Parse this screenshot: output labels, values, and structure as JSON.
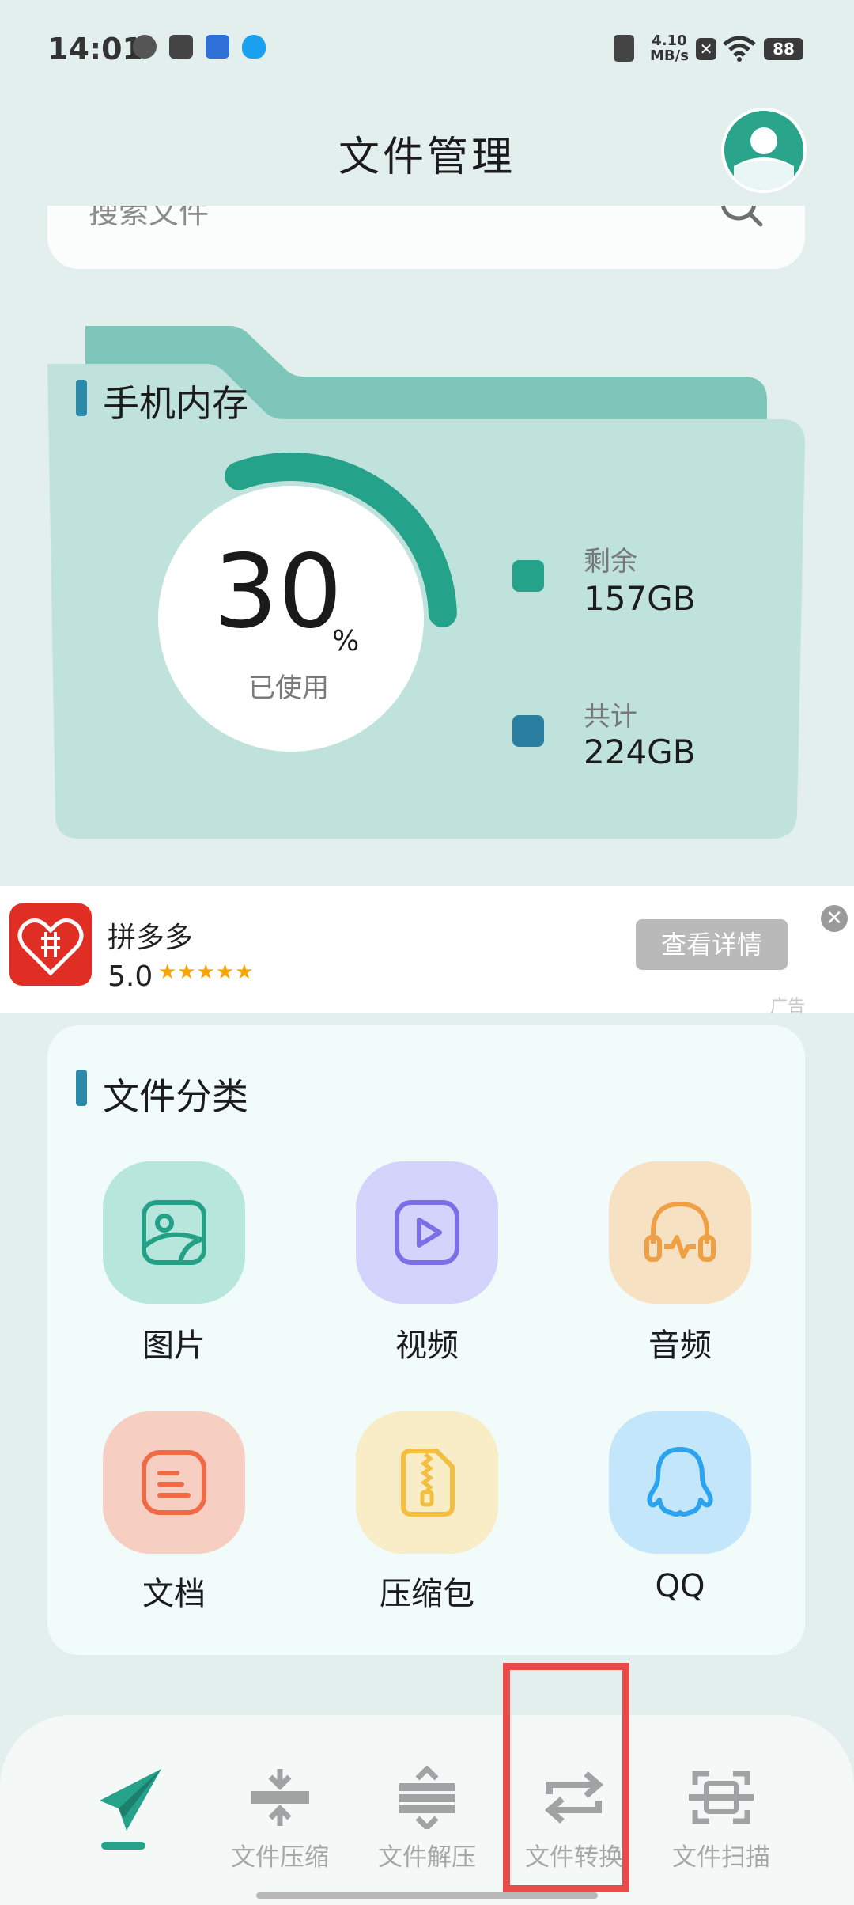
{
  "status_bar": {
    "time": "14:01",
    "network_speed_value": "4.10",
    "network_speed_unit": "MB/s",
    "battery": "88",
    "icons": [
      "vibrate-icon",
      "sim-off-icon",
      "wifi-icon",
      "battery-icon"
    ]
  },
  "header": {
    "title": "文件管理"
  },
  "search": {
    "placeholder": "搜索文件"
  },
  "storage": {
    "title": "手机内存",
    "used_percent": "30",
    "unit": "%",
    "caption": "已使用",
    "remaining_label": "剩余",
    "remaining_value": "157GB",
    "total_label": "共计",
    "total_value": "224GB",
    "remaining_gb": 157,
    "total_gb": 224,
    "colors": {
      "ring": "#25a38a",
      "remaining": "#25a38a",
      "total": "#2a7fa0"
    }
  },
  "ad": {
    "app_name": "拼多多",
    "rating": "5.0",
    "stars": "★★★★★",
    "button": "查看详情",
    "close": "✕",
    "tag": "广告"
  },
  "categories": {
    "title": "文件分类",
    "items": [
      {
        "label": "图片",
        "icon": "image-icon"
      },
      {
        "label": "视频",
        "icon": "video-icon"
      },
      {
        "label": "音频",
        "icon": "audio-icon"
      },
      {
        "label": "文档",
        "icon": "document-icon"
      },
      {
        "label": "压缩包",
        "icon": "archive-icon"
      },
      {
        "label": "QQ",
        "icon": "qq-icon"
      }
    ]
  },
  "bottom_nav": {
    "items": [
      {
        "label": "",
        "icon": "send-icon",
        "active": true
      },
      {
        "label": "文件压缩",
        "icon": "compress-icon"
      },
      {
        "label": "文件解压",
        "icon": "decompress-icon"
      },
      {
        "label": "文件转换",
        "icon": "convert-icon"
      },
      {
        "label": "文件扫描",
        "icon": "scan-icon"
      }
    ]
  },
  "colors": {
    "background": "#e3efec",
    "accent": "#25a38a",
    "highlight": "#e94b4b"
  }
}
